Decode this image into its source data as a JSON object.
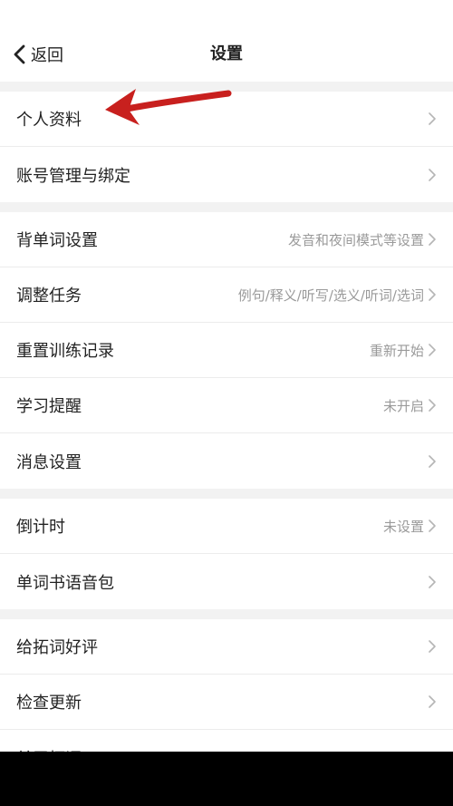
{
  "header": {
    "back_label": "返回",
    "title": "设置"
  },
  "sections": [
    {
      "rows": [
        {
          "label": "个人资料",
          "value": ""
        },
        {
          "label": "账号管理与绑定",
          "value": ""
        }
      ]
    },
    {
      "rows": [
        {
          "label": "背单词设置",
          "value": "发音和夜间模式等设置"
        },
        {
          "label": "调整任务",
          "value": "例句/释义/听写/选义/听词/选词"
        },
        {
          "label": "重置训练记录",
          "value": "重新开始"
        },
        {
          "label": "学习提醒",
          "value": "未开启"
        },
        {
          "label": "消息设置",
          "value": ""
        }
      ]
    },
    {
      "rows": [
        {
          "label": "倒计时",
          "value": "未设置"
        },
        {
          "label": "单词书语音包",
          "value": ""
        }
      ]
    },
    {
      "rows": [
        {
          "label": "给拓词好评",
          "value": ""
        },
        {
          "label": "检查更新",
          "value": ""
        },
        {
          "label": "关于拓词",
          "value": ""
        }
      ]
    }
  ],
  "icons": {
    "back": "chevron-left-icon",
    "row_arrow": "chevron-right-icon",
    "annotation": "red-arrow-icon"
  },
  "colors": {
    "annotation_arrow": "#c8201e",
    "section_gap": "#f2f2f2",
    "value_text": "#9a9a9a"
  }
}
